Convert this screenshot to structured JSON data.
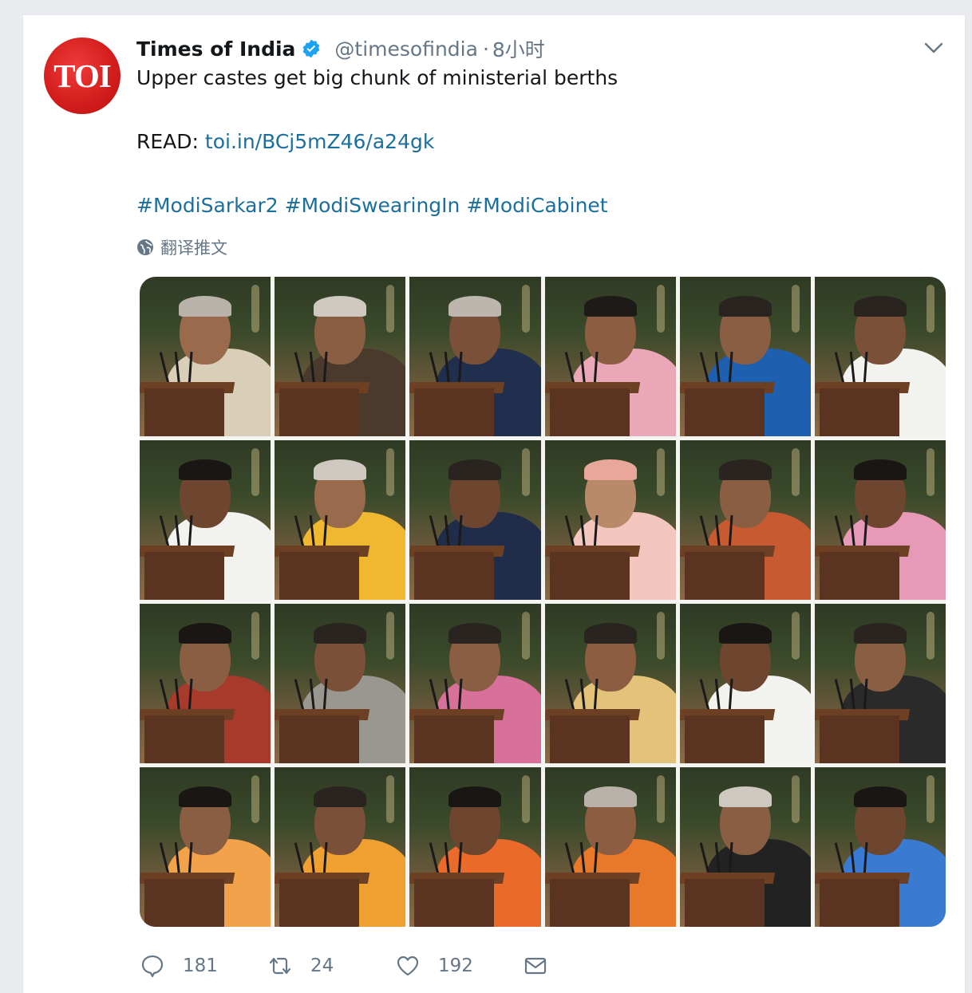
{
  "tweet": {
    "avatar_text": "TOI",
    "display_name": "Times of India",
    "handle": "@timesofindia",
    "separator": "·",
    "time": "8小时",
    "text_line1": "Upper castes get big chunk of ministerial berths",
    "read_label": "READ:",
    "read_link": "toi.in/BCj5mZ46/a24gk",
    "hashtags": [
      "#ModiSarkar2",
      "#ModiSwearingIn",
      "#ModiCabinet"
    ],
    "translate_label": "翻译推文",
    "image_alt": "Ministers taking oath",
    "tiles": [
      {
        "garment": "#d9cfb8",
        "head": "#9a6a4c",
        "hair": "#b9b2aa"
      },
      {
        "garment": "#4a3a2c",
        "head": "#8a5e42",
        "hair": "#cfc8c0"
      },
      {
        "garment": "#1f2f4d",
        "head": "#7a5038",
        "hair": "#bdb6ae"
      },
      {
        "garment": "#e9a7b8",
        "head": "#8c5d40",
        "hair": "#1e1a18"
      },
      {
        "garment": "#1f5fb0",
        "head": "#8a5e42",
        "hair": "#2a2420"
      },
      {
        "garment": "#f2f2ee",
        "head": "#7a5038",
        "hair": "#2a2420"
      },
      {
        "garment": "#f2f2ee",
        "head": "#6e4630",
        "hair": "#1a1614"
      },
      {
        "garment": "#f0b830",
        "head": "#9a6a4c",
        "hair": "#cfc8c0"
      },
      {
        "garment": "#1f2d4a",
        "head": "#6e4630",
        "hair": "#2a2420"
      },
      {
        "garment": "#f3c7c0",
        "head": "#b88a6a",
        "hair": "#e8a79a"
      },
      {
        "garment": "#c85a32",
        "head": "#8a5e42",
        "hair": "#2a2420"
      },
      {
        "garment": "#e79ab8",
        "head": "#6e4630",
        "hair": "#1a1614"
      },
      {
        "garment": "#a83a2c",
        "head": "#8a5e42",
        "hair": "#1a1614"
      },
      {
        "garment": "#9a9690",
        "head": "#7a5038",
        "hair": "#2a2420"
      },
      {
        "garment": "#d8719a",
        "head": "#8a5e42",
        "hair": "#2a2420"
      },
      {
        "garment": "#e3c27a",
        "head": "#8c5d40",
        "hair": "#2a2420"
      },
      {
        "garment": "#f2f2ee",
        "head": "#6e4630",
        "hair": "#1a1614"
      },
      {
        "garment": "#2a2a2a",
        "head": "#8a5e42",
        "hair": "#2a2420"
      },
      {
        "garment": "#f2a24a",
        "head": "#8a5e42",
        "hair": "#1a1614"
      },
      {
        "garment": "#f0a030",
        "head": "#7a5038",
        "hair": "#2a2420"
      },
      {
        "garment": "#ea6a2a",
        "head": "#6e4630",
        "hair": "#1a1614"
      },
      {
        "garment": "#e8782a",
        "head": "#8c5d40",
        "hair": "#b9b2aa"
      },
      {
        "garment": "#222222",
        "head": "#8a5e42",
        "hair": "#cfc8c0"
      },
      {
        "garment": "#3a7ad0",
        "head": "#6e4630",
        "hair": "#1a1614"
      }
    ],
    "actions": {
      "reply": {
        "icon": "reply-icon",
        "count": "181"
      },
      "retweet": {
        "icon": "retweet-icon",
        "count": "24"
      },
      "like": {
        "icon": "heart-icon",
        "count": "192"
      },
      "dm": {
        "icon": "mail-icon"
      }
    }
  },
  "colors": {
    "accent": "#1da1f2",
    "link": "#1b6f9c",
    "muted": "#657786",
    "avatar_red": "#d21c1c"
  }
}
